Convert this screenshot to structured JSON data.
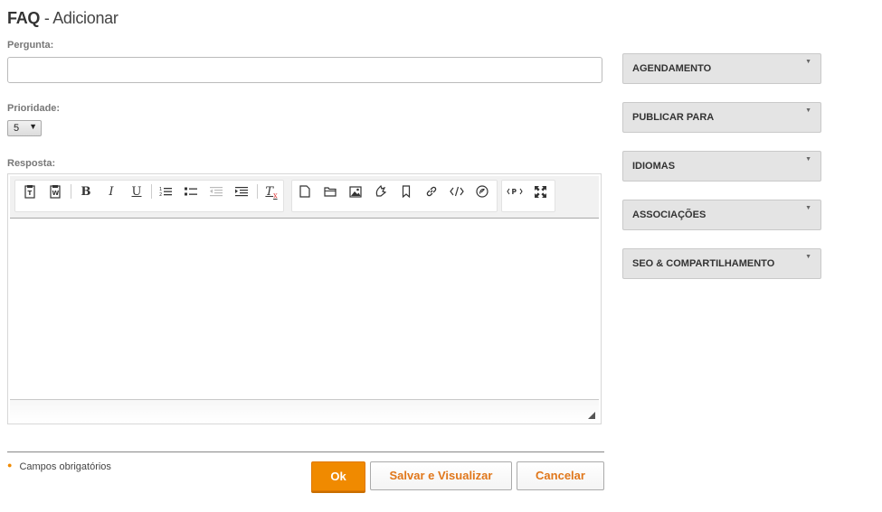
{
  "header": {
    "title_bold": "FAQ",
    "title_rest": "- Adicionar"
  },
  "form": {
    "question_label": "Pergunta:",
    "question_value": "",
    "priority_label": "Prioridade:",
    "priority_value": "5",
    "answer_label": "Resposta:"
  },
  "editor": {
    "toolbar": [
      "paste-text-icon",
      "paste-word-icon",
      "bold-icon",
      "italic-icon",
      "underline-icon",
      "numbered-list-icon",
      "bulleted-list-icon",
      "outdent-icon",
      "indent-icon",
      "remove-format-icon",
      "new-page-icon",
      "browse-server-icon",
      "image-icon",
      "flash-icon",
      "anchor-icon",
      "link-icon",
      "embed-code-icon",
      "special-icon",
      "source-icon",
      "maximize-icon"
    ],
    "labels": {
      "bold": "B",
      "italic": "I",
      "underline": "U",
      "clear": "T"
    }
  },
  "footer": {
    "required_note": "Campos obrigatórios",
    "ok_label": "Ok",
    "save_view_label": "Salvar e Visualizar",
    "cancel_label": "Cancelar"
  },
  "sidebar": {
    "panels": [
      {
        "label": "AGENDAMENTO"
      },
      {
        "label": "PUBLICAR PARA"
      },
      {
        "label": "IDIOMAS"
      },
      {
        "label": "ASSOCIAÇÕES"
      },
      {
        "label": "SEO & COMPARTILHAMENTO"
      }
    ]
  },
  "colors": {
    "accent": "#f08a00",
    "link_text": "#e0771b",
    "panel_bg": "#e4e4e4"
  }
}
